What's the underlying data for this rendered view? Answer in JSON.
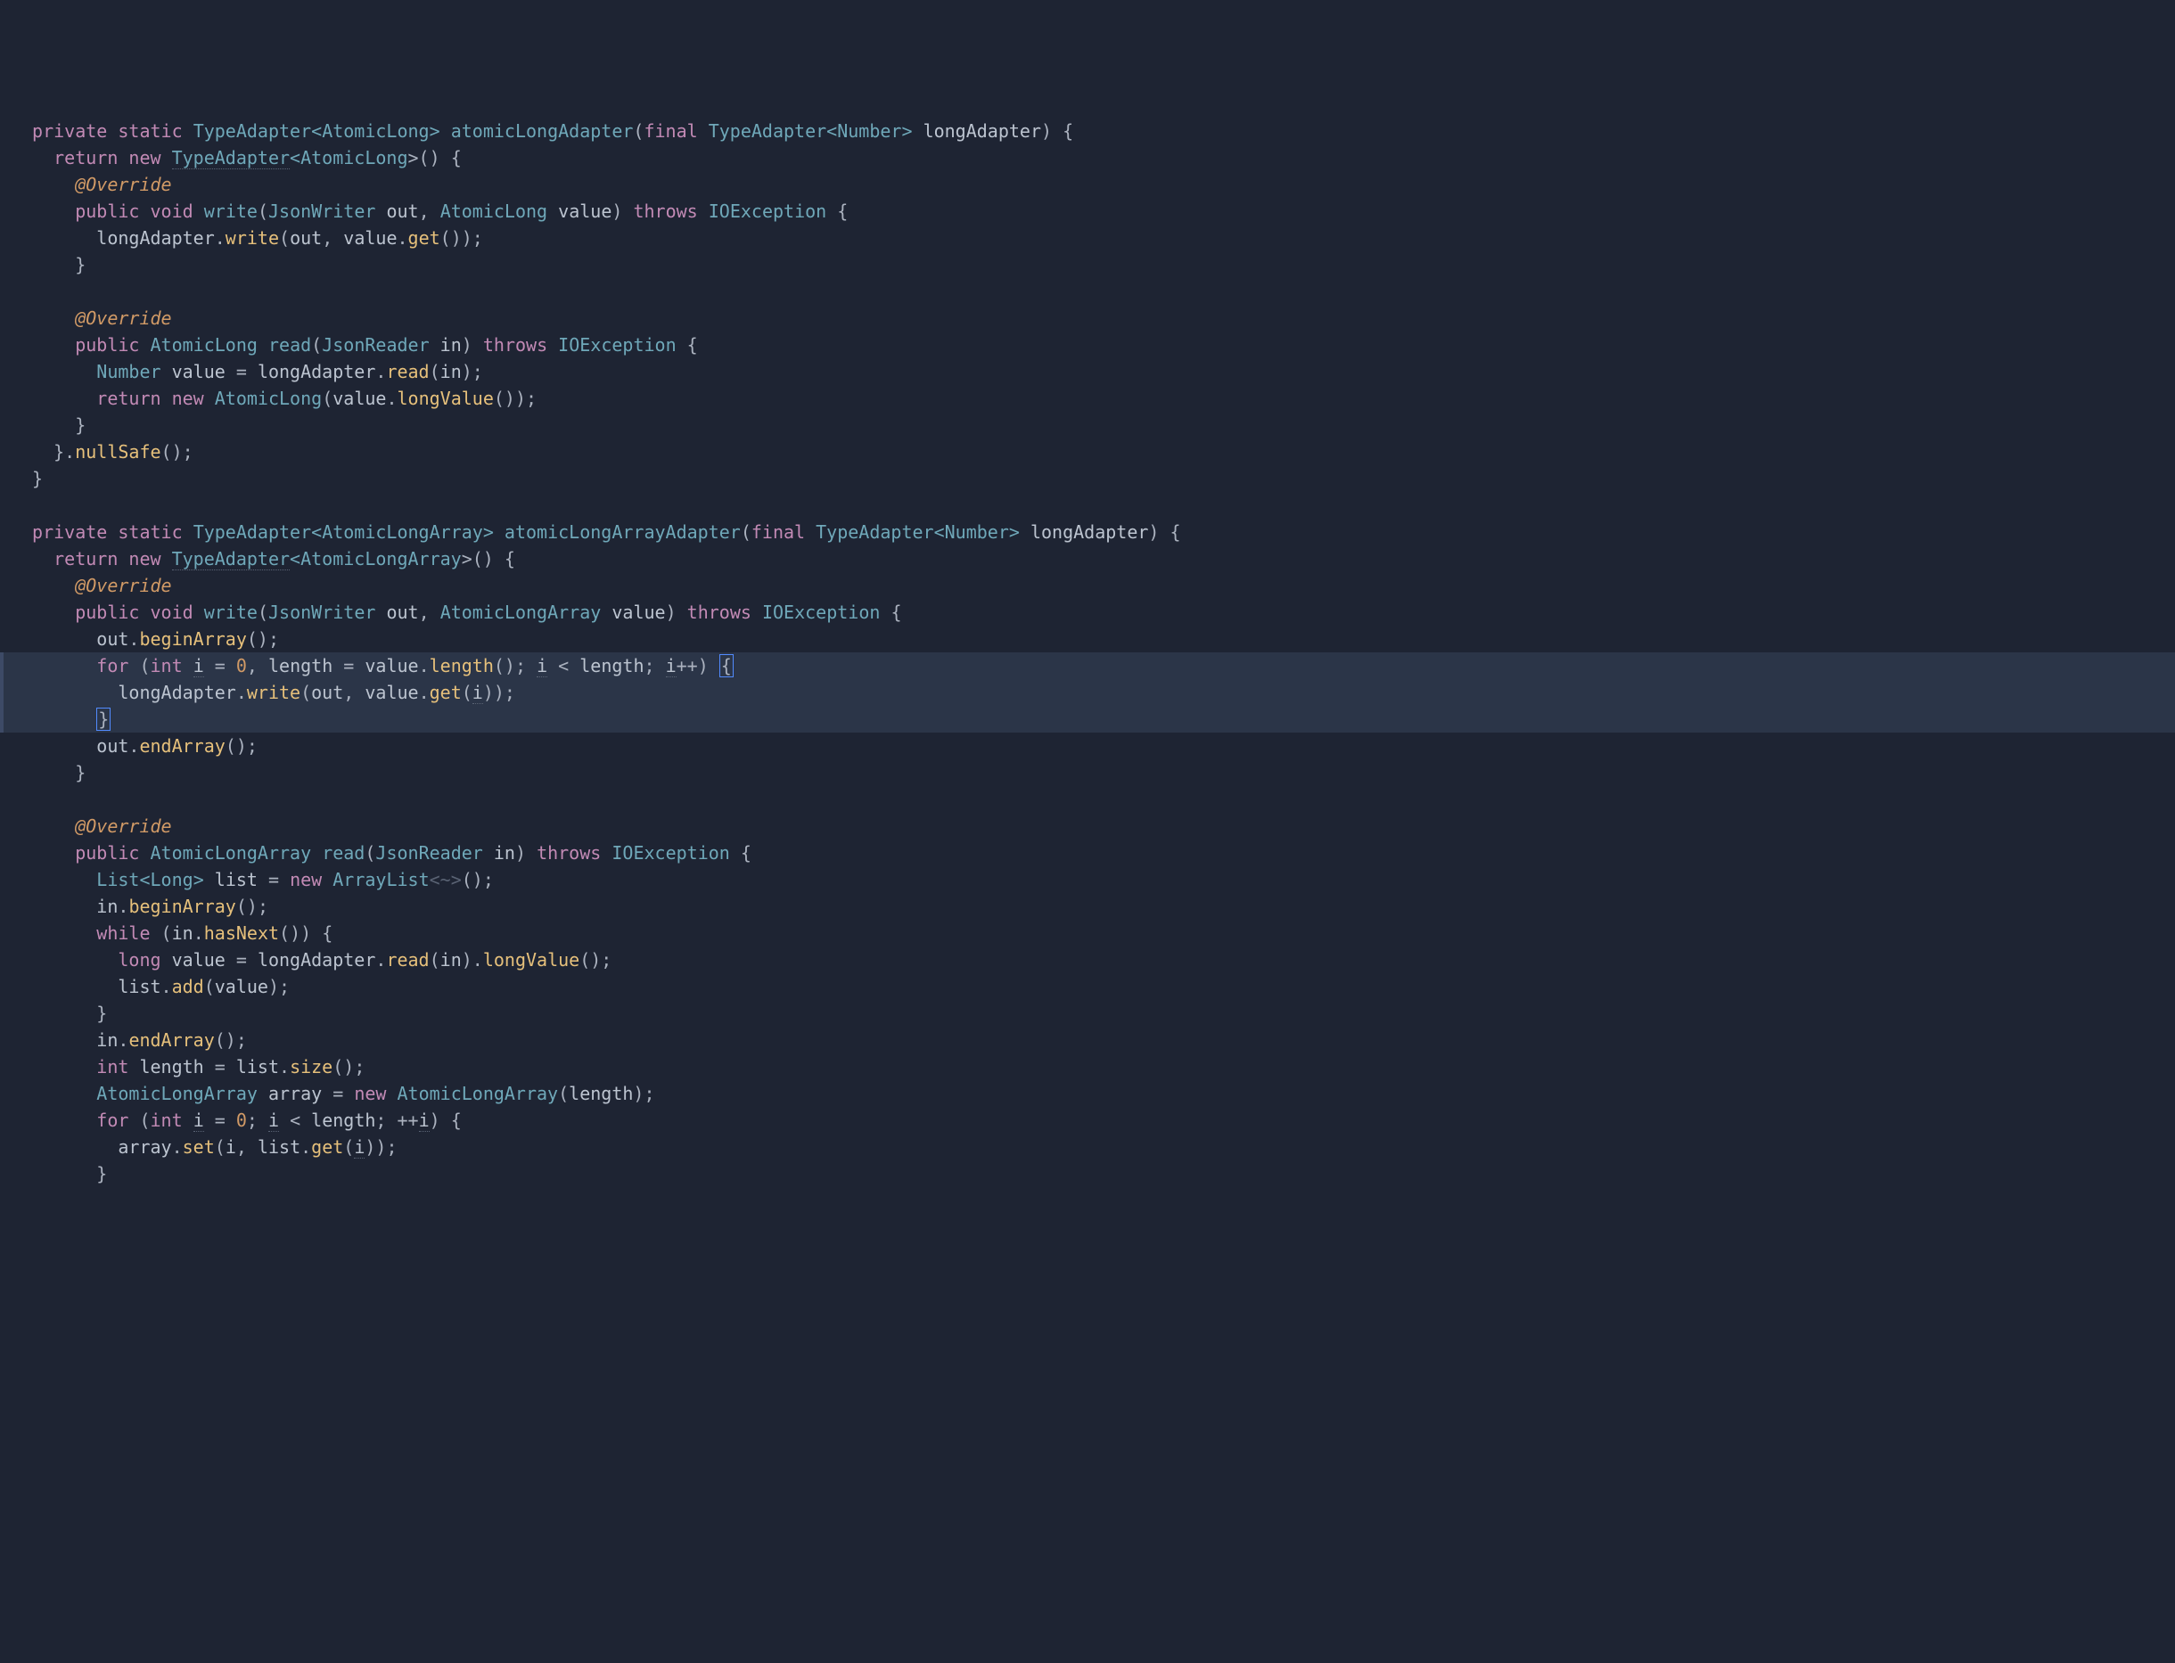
{
  "lines": [
    [
      [
        " ",
        "sp"
      ],
      [
        "private",
        "kw"
      ],
      [
        " ",
        "sp"
      ],
      [
        "static",
        "kw"
      ],
      [
        " ",
        "sp"
      ],
      [
        "TypeAdapter",
        "type"
      ],
      [
        "<",
        "op"
      ],
      [
        "AtomicLong",
        "type"
      ],
      [
        ">",
        "op"
      ],
      [
        " ",
        "sp"
      ],
      [
        "atomicLongAdapter",
        "funcDef"
      ],
      [
        "(",
        "paren"
      ],
      [
        "final",
        "kw"
      ],
      [
        " ",
        "sp"
      ],
      [
        "TypeAdapter",
        "type"
      ],
      [
        "<",
        "op"
      ],
      [
        "Number",
        "type"
      ],
      [
        ">",
        "op"
      ],
      [
        " ",
        "sp"
      ],
      [
        "longAdapter",
        "ident"
      ],
      [
        ")",
        "paren"
      ],
      [
        " ",
        "sp"
      ],
      [
        "{",
        "brace"
      ]
    ],
    [
      [
        "   ",
        "sp"
      ],
      [
        "return",
        "kw"
      ],
      [
        " ",
        "sp"
      ],
      [
        "new",
        "kw"
      ],
      [
        " ",
        "sp"
      ],
      [
        "TypeAdapter",
        "typeU"
      ],
      [
        "<",
        "op"
      ],
      [
        "AtomicLong",
        "type"
      ],
      [
        ">()",
        "paren"
      ],
      [
        " ",
        "sp"
      ],
      [
        "{",
        "brace"
      ]
    ],
    [
      [
        "     ",
        "sp"
      ],
      [
        "@Override",
        "ann"
      ]
    ],
    [
      [
        "     ",
        "sp"
      ],
      [
        "public",
        "kw"
      ],
      [
        " ",
        "sp"
      ],
      [
        "void",
        "kw"
      ],
      [
        " ",
        "sp"
      ],
      [
        "write",
        "funcDef"
      ],
      [
        "(",
        "paren"
      ],
      [
        "JsonWriter",
        "type"
      ],
      [
        " ",
        "sp"
      ],
      [
        "out",
        "ident"
      ],
      [
        ", ",
        "punct"
      ],
      [
        "AtomicLong",
        "type"
      ],
      [
        " ",
        "sp"
      ],
      [
        "value",
        "ident"
      ],
      [
        ")",
        "paren"
      ],
      [
        " ",
        "sp"
      ],
      [
        "throws",
        "kw"
      ],
      [
        " ",
        "sp"
      ],
      [
        "IOException",
        "type"
      ],
      [
        " ",
        "sp"
      ],
      [
        "{",
        "brace"
      ]
    ],
    [
      [
        "       ",
        "sp"
      ],
      [
        "longAdapter",
        "ident"
      ],
      [
        ".",
        "punct"
      ],
      [
        "write",
        "funcCall"
      ],
      [
        "(",
        "paren"
      ],
      [
        "out",
        "ident"
      ],
      [
        ", ",
        "punct"
      ],
      [
        "value",
        "ident"
      ],
      [
        ".",
        "punct"
      ],
      [
        "get",
        "funcCall"
      ],
      [
        "());",
        "paren"
      ]
    ],
    [
      [
        "     ",
        "sp"
      ],
      [
        "}",
        "brace"
      ]
    ],
    [
      [
        ""
      ]
    ],
    [
      [
        "     ",
        "sp"
      ],
      [
        "@Override",
        "ann"
      ]
    ],
    [
      [
        "     ",
        "sp"
      ],
      [
        "public",
        "kw"
      ],
      [
        " ",
        "sp"
      ],
      [
        "AtomicLong",
        "type"
      ],
      [
        " ",
        "sp"
      ],
      [
        "read",
        "funcDef"
      ],
      [
        "(",
        "paren"
      ],
      [
        "JsonReader",
        "type"
      ],
      [
        " ",
        "sp"
      ],
      [
        "in",
        "ident"
      ],
      [
        ")",
        "paren"
      ],
      [
        " ",
        "sp"
      ],
      [
        "throws",
        "kw"
      ],
      [
        " ",
        "sp"
      ],
      [
        "IOException",
        "type"
      ],
      [
        " ",
        "sp"
      ],
      [
        "{",
        "brace"
      ]
    ],
    [
      [
        "       ",
        "sp"
      ],
      [
        "Number",
        "type"
      ],
      [
        " ",
        "sp"
      ],
      [
        "value",
        "ident"
      ],
      [
        " = ",
        "punct"
      ],
      [
        "longAdapter",
        "ident"
      ],
      [
        ".",
        "punct"
      ],
      [
        "read",
        "funcCall"
      ],
      [
        "(",
        "paren"
      ],
      [
        "in",
        "ident"
      ],
      [
        ");",
        "paren"
      ]
    ],
    [
      [
        "       ",
        "sp"
      ],
      [
        "return",
        "kw"
      ],
      [
        " ",
        "sp"
      ],
      [
        "new",
        "kw"
      ],
      [
        " ",
        "sp"
      ],
      [
        "AtomicLong",
        "type"
      ],
      [
        "(",
        "paren"
      ],
      [
        "value",
        "ident"
      ],
      [
        ".",
        "punct"
      ],
      [
        "longValue",
        "funcCall"
      ],
      [
        "());",
        "paren"
      ]
    ],
    [
      [
        "     ",
        "sp"
      ],
      [
        "}",
        "brace"
      ]
    ],
    [
      [
        "   ",
        "sp"
      ],
      [
        "}.",
        "brace"
      ],
      [
        "nullSafe",
        "funcCall"
      ],
      [
        "();",
        "paren"
      ]
    ],
    [
      [
        " ",
        "sp"
      ],
      [
        "}",
        "brace"
      ]
    ],
    [
      [
        ""
      ]
    ],
    [
      [
        " ",
        "sp"
      ],
      [
        "private",
        "kw"
      ],
      [
        " ",
        "sp"
      ],
      [
        "static",
        "kw"
      ],
      [
        " ",
        "sp"
      ],
      [
        "TypeAdapter",
        "type"
      ],
      [
        "<",
        "op"
      ],
      [
        "AtomicLongArray",
        "type"
      ],
      [
        ">",
        "op"
      ],
      [
        " ",
        "sp"
      ],
      [
        "atomicLongArrayAdapter",
        "funcDef"
      ],
      [
        "(",
        "paren"
      ],
      [
        "final",
        "kw"
      ],
      [
        " ",
        "sp"
      ],
      [
        "TypeAdapter",
        "type"
      ],
      [
        "<",
        "op"
      ],
      [
        "Number",
        "type"
      ],
      [
        ">",
        "op"
      ],
      [
        " ",
        "sp"
      ],
      [
        "longAdapter",
        "ident"
      ],
      [
        ")",
        "paren"
      ],
      [
        " ",
        "sp"
      ],
      [
        "{",
        "brace"
      ]
    ],
    [
      [
        "   ",
        "sp"
      ],
      [
        "return",
        "kw"
      ],
      [
        " ",
        "sp"
      ],
      [
        "new",
        "kw"
      ],
      [
        " ",
        "sp"
      ],
      [
        "TypeAdapter",
        "typeU"
      ],
      [
        "<",
        "op"
      ],
      [
        "AtomicLongArray",
        "type"
      ],
      [
        ">()",
        "paren"
      ],
      [
        " ",
        "sp"
      ],
      [
        "{",
        "brace"
      ]
    ],
    [
      [
        "     ",
        "sp"
      ],
      [
        "@Override",
        "ann"
      ]
    ],
    [
      [
        "     ",
        "sp"
      ],
      [
        "public",
        "kw"
      ],
      [
        " ",
        "sp"
      ],
      [
        "void",
        "kw"
      ],
      [
        " ",
        "sp"
      ],
      [
        "write",
        "funcDef"
      ],
      [
        "(",
        "paren"
      ],
      [
        "JsonWriter",
        "type"
      ],
      [
        " ",
        "sp"
      ],
      [
        "out",
        "ident"
      ],
      [
        ", ",
        "punct"
      ],
      [
        "AtomicLongArray",
        "type"
      ],
      [
        " ",
        "sp"
      ],
      [
        "value",
        "ident"
      ],
      [
        ")",
        "paren"
      ],
      [
        " ",
        "sp"
      ],
      [
        "throws",
        "kw"
      ],
      [
        " ",
        "sp"
      ],
      [
        "IOException",
        "type"
      ],
      [
        " ",
        "sp"
      ],
      [
        "{",
        "brace"
      ]
    ],
    [
      [
        "       ",
        "sp"
      ],
      [
        "out",
        "ident"
      ],
      [
        ".",
        "punct"
      ],
      [
        "beginArray",
        "funcCall"
      ],
      [
        "();",
        "paren"
      ]
    ],
    [
      [
        "       ",
        "sp"
      ],
      [
        "for",
        "kw"
      ],
      [
        " (",
        "paren"
      ],
      [
        "int",
        "kw"
      ],
      [
        " ",
        "sp"
      ],
      [
        "i",
        "identU"
      ],
      [
        " = ",
        "punct"
      ],
      [
        "0",
        "num"
      ],
      [
        ", ",
        "punct"
      ],
      [
        "length",
        "ident"
      ],
      [
        " = ",
        "punct"
      ],
      [
        "value",
        "ident"
      ],
      [
        ".",
        "punct"
      ],
      [
        "length",
        "funcCall"
      ],
      [
        "(); ",
        "paren"
      ],
      [
        "i",
        "identU"
      ],
      [
        " < ",
        "punct"
      ],
      [
        "length",
        "ident"
      ],
      [
        "; ",
        "punct"
      ],
      [
        "i",
        "identU"
      ],
      [
        "++) ",
        "paren"
      ],
      [
        "{",
        "bracket-box"
      ]
    ],
    [
      [
        "         ",
        "sp"
      ],
      [
        "longAdapter",
        "ident"
      ],
      [
        ".",
        "punct"
      ],
      [
        "write",
        "funcCall"
      ],
      [
        "(",
        "paren"
      ],
      [
        "out",
        "ident"
      ],
      [
        ", ",
        "punct"
      ],
      [
        "value",
        "ident"
      ],
      [
        ".",
        "punct"
      ],
      [
        "get",
        "funcCall"
      ],
      [
        "(",
        "paren"
      ],
      [
        "i",
        "identU"
      ],
      [
        "));",
        "paren"
      ]
    ],
    [
      [
        "       ",
        "sp"
      ],
      [
        "}",
        "bracket-box"
      ]
    ],
    [
      [
        "       ",
        "sp"
      ],
      [
        "out",
        "ident"
      ],
      [
        ".",
        "punct"
      ],
      [
        "endArray",
        "funcCall"
      ],
      [
        "();",
        "paren"
      ]
    ],
    [
      [
        "     ",
        "sp"
      ],
      [
        "}",
        "brace"
      ]
    ],
    [
      [
        ""
      ]
    ],
    [
      [
        "     ",
        "sp"
      ],
      [
        "@Override",
        "ann"
      ]
    ],
    [
      [
        "     ",
        "sp"
      ],
      [
        "public",
        "kw"
      ],
      [
        " ",
        "sp"
      ],
      [
        "AtomicLongArray",
        "type"
      ],
      [
        " ",
        "sp"
      ],
      [
        "read",
        "funcDef"
      ],
      [
        "(",
        "paren"
      ],
      [
        "JsonReader",
        "type"
      ],
      [
        " ",
        "sp"
      ],
      [
        "in",
        "ident"
      ],
      [
        ")",
        "paren"
      ],
      [
        " ",
        "sp"
      ],
      [
        "throws",
        "kw"
      ],
      [
        " ",
        "sp"
      ],
      [
        "IOException",
        "type"
      ],
      [
        " ",
        "sp"
      ],
      [
        "{",
        "brace"
      ]
    ],
    [
      [
        "       ",
        "sp"
      ],
      [
        "List",
        "type"
      ],
      [
        "<",
        "op"
      ],
      [
        "Long",
        "type"
      ],
      [
        ">",
        "op"
      ],
      [
        " ",
        "sp"
      ],
      [
        "list",
        "ident"
      ],
      [
        " = ",
        "punct"
      ],
      [
        "new",
        "kw"
      ],
      [
        " ",
        "sp"
      ],
      [
        "ArrayList",
        "type"
      ],
      [
        "<~>",
        "hint"
      ],
      [
        "();",
        "paren"
      ]
    ],
    [
      [
        "       ",
        "sp"
      ],
      [
        "in",
        "ident"
      ],
      [
        ".",
        "punct"
      ],
      [
        "beginArray",
        "funcCall"
      ],
      [
        "();",
        "paren"
      ]
    ],
    [
      [
        "       ",
        "sp"
      ],
      [
        "while",
        "kw"
      ],
      [
        " (",
        "paren"
      ],
      [
        "in",
        "ident"
      ],
      [
        ".",
        "punct"
      ],
      [
        "hasNext",
        "funcCall"
      ],
      [
        "()) ",
        "paren"
      ],
      [
        "{",
        "brace"
      ]
    ],
    [
      [
        "         ",
        "sp"
      ],
      [
        "long",
        "kw"
      ],
      [
        " ",
        "sp"
      ],
      [
        "value",
        "ident"
      ],
      [
        " = ",
        "punct"
      ],
      [
        "longAdapter",
        "ident"
      ],
      [
        ".",
        "punct"
      ],
      [
        "read",
        "funcCall"
      ],
      [
        "(",
        "paren"
      ],
      [
        "in",
        "ident"
      ],
      [
        ").",
        "paren"
      ],
      [
        "longValue",
        "funcCall"
      ],
      [
        "();",
        "paren"
      ]
    ],
    [
      [
        "         ",
        "sp"
      ],
      [
        "list",
        "ident"
      ],
      [
        ".",
        "punct"
      ],
      [
        "add",
        "funcCall"
      ],
      [
        "(",
        "paren"
      ],
      [
        "value",
        "ident"
      ],
      [
        ");",
        "paren"
      ]
    ],
    [
      [
        "       ",
        "sp"
      ],
      [
        "}",
        "brace"
      ]
    ],
    [
      [
        "       ",
        "sp"
      ],
      [
        "in",
        "ident"
      ],
      [
        ".",
        "punct"
      ],
      [
        "endArray",
        "funcCall"
      ],
      [
        "();",
        "paren"
      ]
    ],
    [
      [
        "       ",
        "sp"
      ],
      [
        "int",
        "kw"
      ],
      [
        " ",
        "sp"
      ],
      [
        "length",
        "ident"
      ],
      [
        " = ",
        "punct"
      ],
      [
        "list",
        "ident"
      ],
      [
        ".",
        "punct"
      ],
      [
        "size",
        "funcCall"
      ],
      [
        "();",
        "paren"
      ]
    ],
    [
      [
        "       ",
        "sp"
      ],
      [
        "AtomicLongArray",
        "type"
      ],
      [
        " ",
        "sp"
      ],
      [
        "array",
        "ident"
      ],
      [
        " = ",
        "punct"
      ],
      [
        "new",
        "kw"
      ],
      [
        " ",
        "sp"
      ],
      [
        "AtomicLongArray",
        "type"
      ],
      [
        "(",
        "paren"
      ],
      [
        "length",
        "ident"
      ],
      [
        ");",
        "paren"
      ]
    ],
    [
      [
        "       ",
        "sp"
      ],
      [
        "for",
        "kw"
      ],
      [
        " (",
        "paren"
      ],
      [
        "int",
        "kw"
      ],
      [
        " ",
        "sp"
      ],
      [
        "i",
        "identU"
      ],
      [
        " = ",
        "punct"
      ],
      [
        "0",
        "num"
      ],
      [
        "; ",
        "punct"
      ],
      [
        "i",
        "identU"
      ],
      [
        " < ",
        "punct"
      ],
      [
        "length",
        "ident"
      ],
      [
        "; ++",
        "punct"
      ],
      [
        "i",
        "identU"
      ],
      [
        ") ",
        "paren"
      ],
      [
        "{",
        "brace"
      ]
    ],
    [
      [
        "         ",
        "sp"
      ],
      [
        "array",
        "ident"
      ],
      [
        ".",
        "punct"
      ],
      [
        "set",
        "funcCall"
      ],
      [
        "(",
        "paren"
      ],
      [
        "i",
        "ident"
      ],
      [
        ", ",
        "punct"
      ],
      [
        "list",
        "ident"
      ],
      [
        ".",
        "punct"
      ],
      [
        "get",
        "funcCall"
      ],
      [
        "(",
        "paren"
      ],
      [
        "i",
        "identU"
      ],
      [
        "));",
        "paren"
      ]
    ],
    [
      [
        "       ",
        "sp"
      ],
      [
        "}",
        "brace"
      ]
    ]
  ],
  "highlighted": [
    20,
    21,
    22
  ]
}
